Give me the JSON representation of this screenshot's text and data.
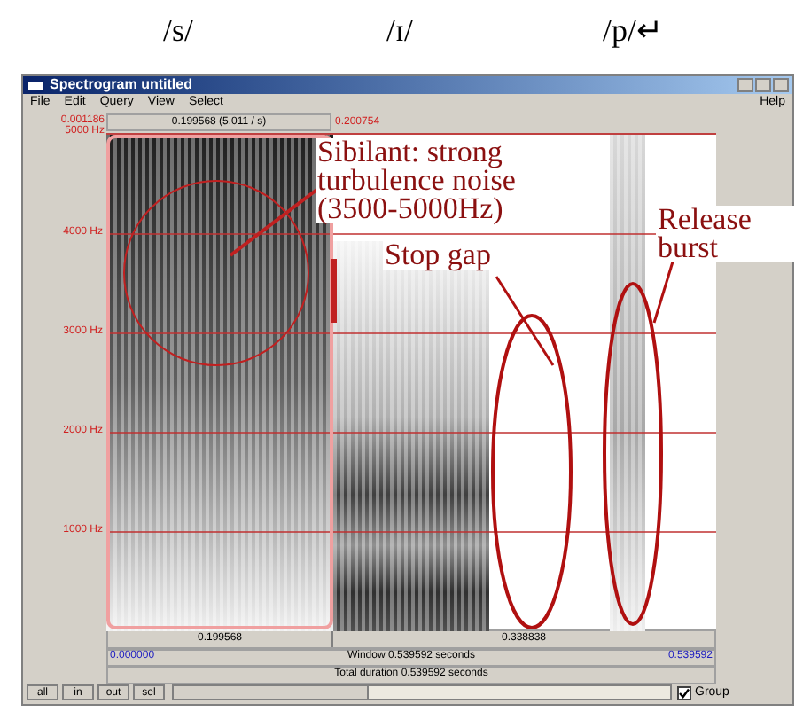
{
  "phoneme_labels": [
    "/s/",
    "/ɪ/",
    "/p/↵"
  ],
  "window": {
    "title": "Spectrogram untitled",
    "menus": [
      "File",
      "Edit",
      "Query",
      "View",
      "Select"
    ],
    "help": "Help"
  },
  "header": {
    "top_time": "0.001186",
    "top_frequency": "5000 Hz",
    "selection_button": "0.199568 (5.011 / s)",
    "cursor_time": "0.200754"
  },
  "frequency_labels": [
    "4000 Hz",
    "3000 Hz",
    "2000 Hz",
    "1000 Hz"
  ],
  "annotations": [
    {
      "lines": [
        "Sibilant: strong",
        "turbulence noise",
        "(3500-5000Hz)"
      ]
    },
    {
      "lines": [
        "Stop gap"
      ]
    },
    {
      "lines": [
        "Release",
        "burst"
      ]
    }
  ],
  "segments": [
    "0.199568",
    "0.338838"
  ],
  "window_row": {
    "start": "0.000000",
    "label": "Window 0.539592 seconds",
    "end": "0.539592"
  },
  "total_duration": "Total duration 0.539592 seconds",
  "buttons": [
    "all",
    "in",
    "out",
    "sel"
  ],
  "group": {
    "label": "Group",
    "checked": true
  }
}
